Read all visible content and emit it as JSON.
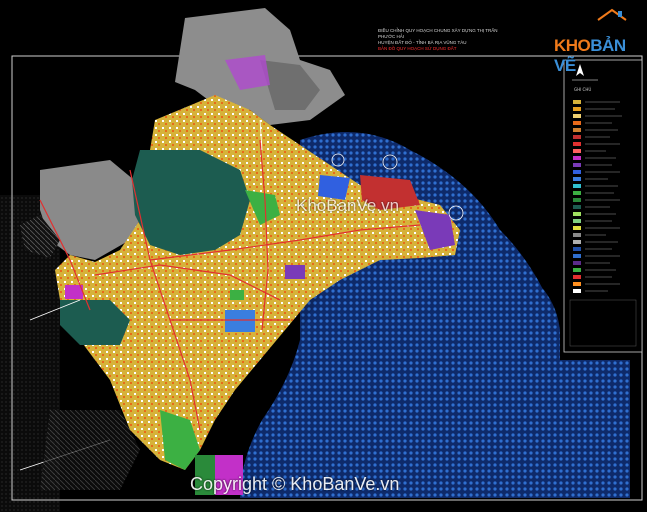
{
  "logo": {
    "part1": "KHO",
    "part2": "BẢN VẼ"
  },
  "title": {
    "line1": "ĐIỀU CHỈNH QUY HOẠCH CHUNG XÂY DỰNG THỊ TRẤN PHƯỚC HẢI",
    "line2": "HUYỆN ĐẤT ĐỎ - TỈNH BÀ RỊA VŨNG TÀU",
    "line3": "BẢN ĐỒ QUY HOẠCH SỬ DỤNG ĐẤT"
  },
  "watermark": {
    "center": "KhoBanVe.vn",
    "bottom": "Copyright © KhoBanVe.vn"
  },
  "legend": {
    "title": "GHI CHÚ"
  },
  "colors": {
    "sea": "#1f4ea8",
    "land_yellow": "#d8b43a",
    "land_orange": "#e6a020",
    "green": "#3cb043",
    "dark_green": "#1c5c50",
    "gray": "#8a8a8a",
    "purple": "#c230c8",
    "brand_orange": "#f07a1a",
    "brand_blue": "#3a8fd8"
  }
}
